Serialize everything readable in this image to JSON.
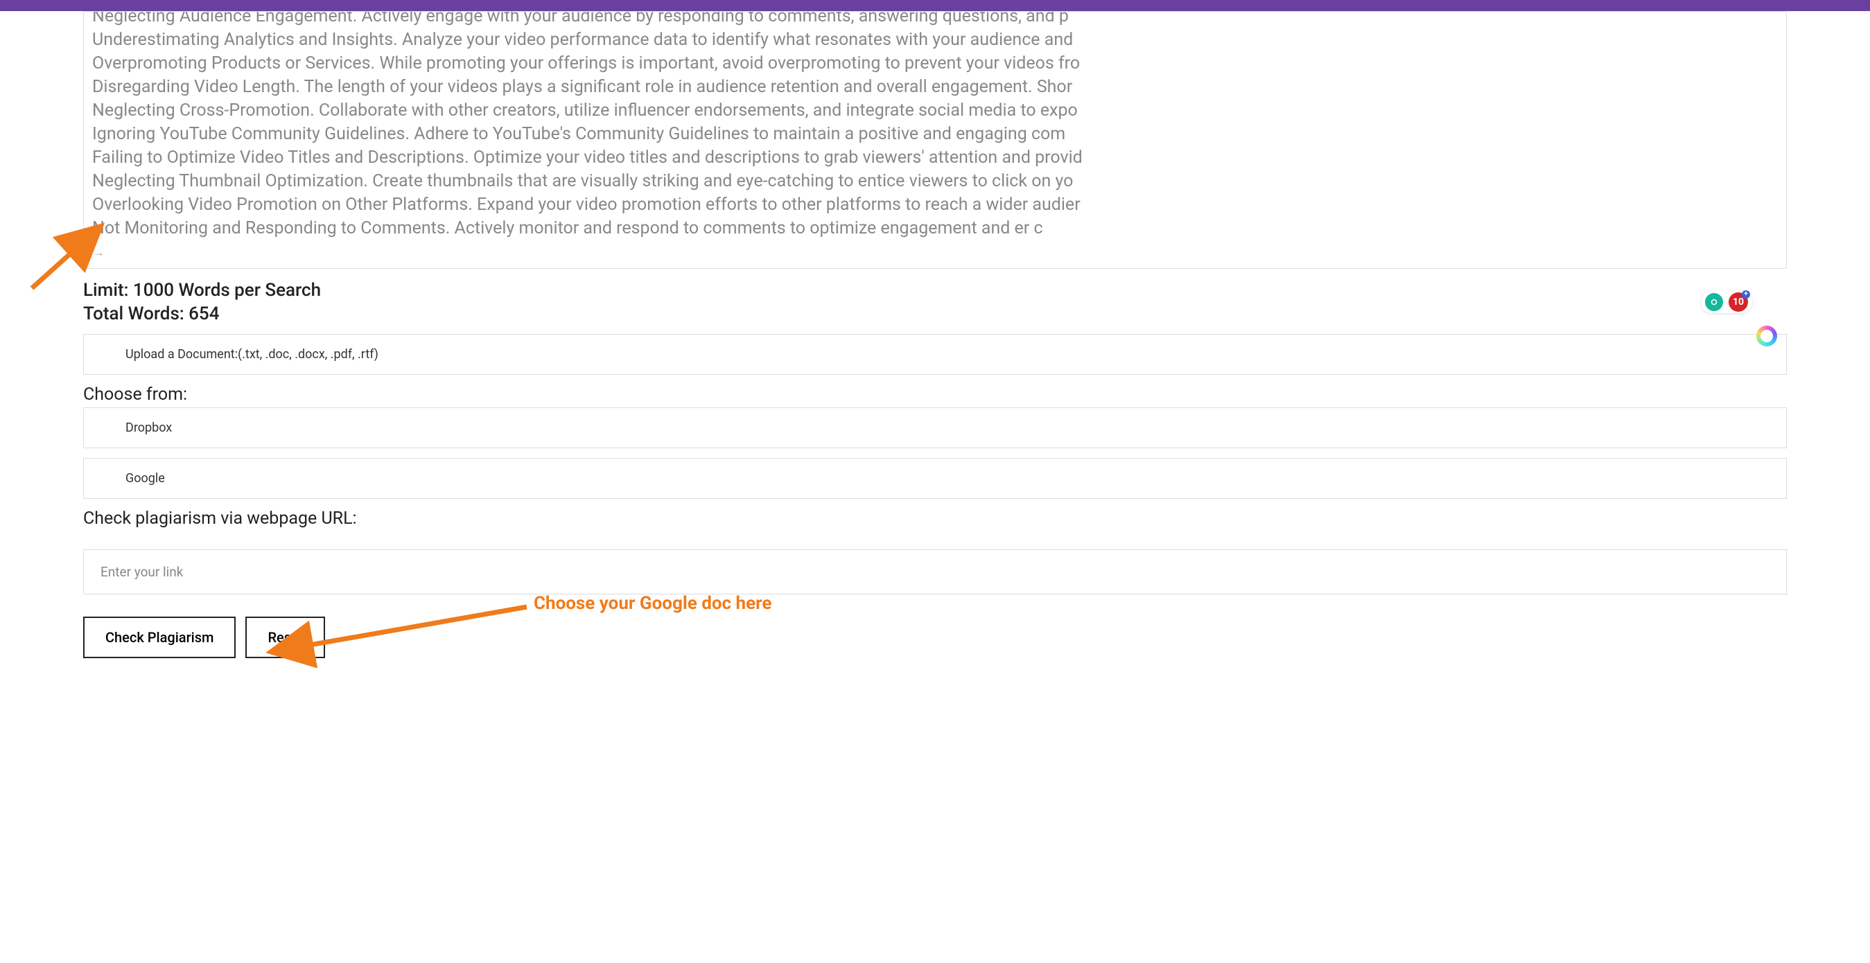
{
  "textarea_lines": [
    "Neglecting Audience Engagement. Actively engage with your audience by responding to comments, answering questions, and p",
    "Underestimating Analytics and Insights. Analyze your video performance data to identify what resonates with your audience and",
    "Overpromoting Products or Services. While promoting your offerings is important, avoid overpromoting to prevent your videos fro",
    "Disregarding Video Length. The length of your videos plays a significant role in audience retention and overall engagement. Shor",
    "Neglecting Cross-Promotion. Collaborate with other creators, utilize influencer endorsements, and integrate social media to expo",
    "Ignoring YouTube Community Guidelines. Adhere to YouTube's Community Guidelines to maintain a positive and engaging com",
    "Failing to Optimize Video Titles and Descriptions. Optimize your video titles and descriptions to grab viewers' attention and provid",
    "Neglecting Thumbnail Optimization. Create thumbnails that are visually striking and eye-catching to entice viewers to click on yo",
    "Overlooking Video Promotion on Other Platforms. Expand your video promotion efforts to other platforms to reach a wider audier",
    "Not Monitoring and Responding to Comments. Actively monitor and respond to comments to optimize engagement and         er c"
  ],
  "limit_label": "Limit: 1000 Words per Search",
  "total_words_label": "Total Words: 654",
  "upload_label": "Upload a Document:(.txt, .doc, .docx, .pdf, .rtf)",
  "choose_from_label": "Choose from:",
  "choose_options": {
    "dropbox": "Dropbox",
    "google": "Google"
  },
  "url_section_label": "Check plagiarism via webpage URL:",
  "url_placeholder": "Enter your link",
  "buttons": {
    "check": "Check Plagiarism",
    "reset": "Reset"
  },
  "annotation": "Choose your Google doc here",
  "badges": {
    "count": "10"
  },
  "colors": {
    "accent_purple": "#6b3fa0",
    "annotation_orange": "#f07b1a"
  }
}
